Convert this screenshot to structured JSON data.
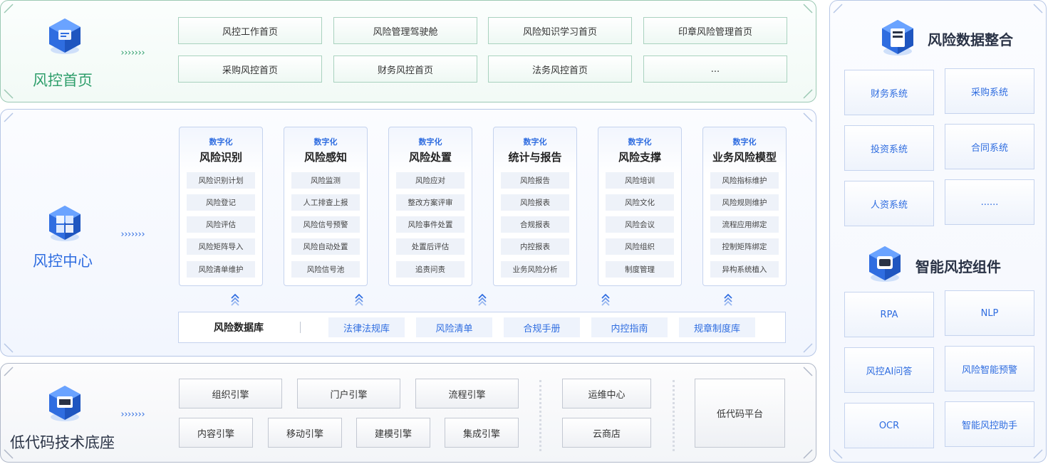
{
  "top": {
    "title": "风控首页",
    "arrows": "›››››››",
    "items": [
      "风控工作首页",
      "风险管理驾驶舱",
      "风险知识学习首页",
      "印章风险管理首页",
      "采购风控首页",
      "财务风控首页",
      "法务风控首页",
      "..."
    ]
  },
  "mid": {
    "title": "风控中心",
    "arrows": "›››››››",
    "columns": [
      {
        "sub": "数字化",
        "title": "风险识别",
        "items": [
          "风险识别计划",
          "风险登记",
          "风险评估",
          "风险矩阵导入",
          "风险清单维护"
        ]
      },
      {
        "sub": "数字化",
        "title": "风险感知",
        "items": [
          "风险监测",
          "人工排查上报",
          "风险信号预警",
          "风险自动处置",
          "风险信号池"
        ]
      },
      {
        "sub": "数字化",
        "title": "风险处置",
        "items": [
          "风险应对",
          "整改方案评审",
          "风险事件处置",
          "处置后评估",
          "追责问责"
        ]
      },
      {
        "sub": "数字化",
        "title": "统计与报告",
        "items": [
          "风险报告",
          "风险报表",
          "合规报表",
          "内控报表",
          "业务风险分析"
        ]
      },
      {
        "sub": "数字化",
        "title": "风险支撑",
        "items": [
          "风险培训",
          "风险文化",
          "风险会议",
          "风险组织",
          "制度管理"
        ]
      },
      {
        "sub": "数字化",
        "title": "业务风险模型",
        "items": [
          "风险指标维护",
          "风险规则维护",
          "流程应用绑定",
          "控制矩阵绑定",
          "异构系统植入"
        ]
      }
    ],
    "database": {
      "title": "风险数据库",
      "items": [
        "法律法规库",
        "风险清单",
        "合规手册",
        "内控指南",
        "规章制度库"
      ]
    }
  },
  "bottom": {
    "title": "低代码技术底座",
    "arrows": "›››››››",
    "engines_row1": [
      "组织引擎",
      "门户引擎",
      "流程引擎"
    ],
    "engines_row2": [
      "内容引擎",
      "移动引擎",
      "建模引擎",
      "集成引擎"
    ],
    "ops": [
      "运维中心",
      "云商店"
    ],
    "platform": "低代码平台"
  },
  "right": {
    "data_title": "风险数据整合",
    "systems": [
      "财务系统",
      "采购系统",
      "投资系统",
      "合同系统",
      "人资系统",
      "......"
    ],
    "comp_title": "智能风控组件",
    "components": [
      "RPA",
      "NLP",
      "风控AI问答",
      "风险智能预警",
      "OCR",
      "智能风控助手"
    ]
  },
  "colors": {
    "green": "#2e9e6b",
    "blue": "#2f6de0",
    "dark": "#2a3346"
  }
}
